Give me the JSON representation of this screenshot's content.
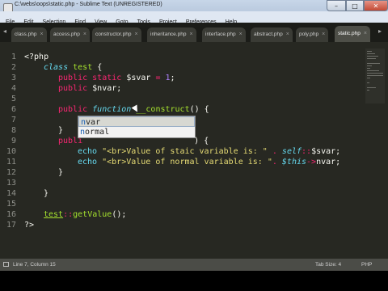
{
  "window": {
    "title": "C:\\webs\\oops\\static.php - Sublime Text (UNREGISTERED)",
    "controls": {
      "minimize": "–",
      "maximize": "□",
      "close": "✕"
    }
  },
  "menu": [
    "File",
    "Edit",
    "Selection",
    "Find",
    "View",
    "Goto",
    "Tools",
    "Project",
    "Preferences",
    "Help"
  ],
  "tabs": [
    {
      "label": "class.php",
      "active": false
    },
    {
      "label": "access.php",
      "active": false
    },
    {
      "label": "constructor.php",
      "active": false
    },
    {
      "label": "inheritance.php",
      "active": false
    },
    {
      "label": "interface.php",
      "active": false
    },
    {
      "label": "abstract.php",
      "active": false
    },
    {
      "label": "poly.php",
      "active": false
    },
    {
      "label": "static.php",
      "active": true
    }
  ],
  "tab_close_glyph": "×",
  "tab_scroll": {
    "left": "◂",
    "right": "▸"
  },
  "line_numbers": [
    "1",
    "2",
    "3",
    "4",
    "5",
    "6",
    "7",
    "8",
    "9",
    "10",
    "11",
    "12",
    "13",
    "14",
    "15",
    "16",
    "17"
  ],
  "code": {
    "l1": "<?php",
    "l2_kw": "class",
    "l2_name": "test",
    "l2_brace": "{",
    "l3_kw1": "public",
    "l3_kw2": "static",
    "l3_var": "$svar",
    "l3_eq": "=",
    "l3_num": "1",
    "l3_end": ";",
    "l4_kw": "public",
    "l4_var": "$nvar;",
    "l6_kw": "public",
    "l6_fn_kw": "function",
    "l6_name": "__construct",
    "l6_rest": "() {",
    "l7_var": "$n",
    "l8_brace": "}",
    "l9_kw": "publi",
    "l9_rest": ") {",
    "l10_echo": "echo",
    "l10_str": "\"<br>Value of staic variable is: \"",
    "l10_dot": ".",
    "l10_self": "self",
    "l10_scope": "::",
    "l10_var": "$svar;",
    "l11_echo": "echo",
    "l11_str": "\"<br>Value of normal variable is: \"",
    "l11_dot": ".",
    "l11_this": "$this",
    "l11_arrow": "->",
    "l11_var": "nvar;",
    "l12_brace": "}",
    "l14_brace": "}",
    "l16_cls": "test",
    "l16_scope": "::",
    "l16_fn": "getValue",
    "l16_rest": "();",
    "l17": "?>"
  },
  "autocomplete": {
    "items": [
      {
        "prefix": "n",
        "rest": "var",
        "selected": true
      },
      {
        "prefix": "n",
        "rest": "ormal",
        "selected": false
      }
    ]
  },
  "status": {
    "position": "Line 7, Column 15",
    "tab_size": "Tab Size: 4",
    "syntax": "PHP"
  },
  "colors": {
    "background": "#272822",
    "keyword": "#66d9ef",
    "operator": "#f92672",
    "string": "#e6db74",
    "number": "#ae81ff",
    "function": "#a6e22e"
  }
}
